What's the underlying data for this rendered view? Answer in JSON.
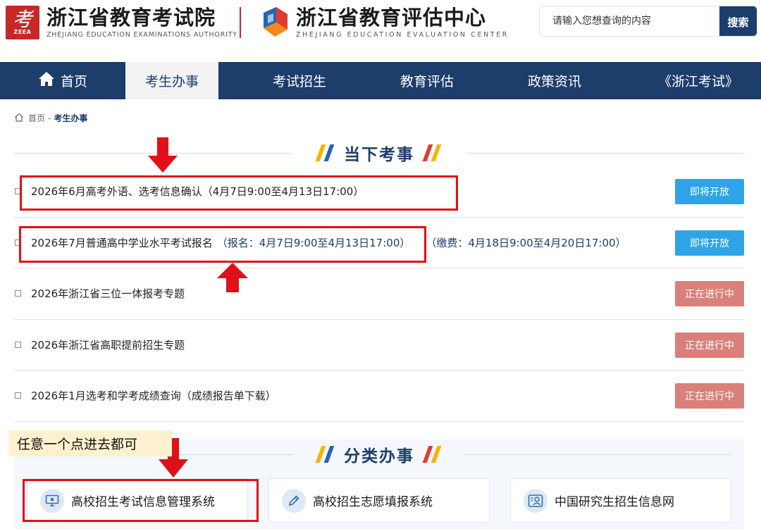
{
  "header": {
    "site1_badge_glyph": "考",
    "site1_badge_abbr": "ZEEA",
    "site1_name": "浙江省教育考试院",
    "site1_name_en": "ZHEJIANG EDUCATION EXAMINATIONS AUTHORITY",
    "site2_name": "浙江省教育评估中心",
    "site2_name_en": "ZHEJIANG EDUCATION EVALUATION CENTER",
    "search_placeholder": "请输入您想查询的内容",
    "search_button": "搜索"
  },
  "nav": {
    "items": [
      {
        "label": "首页",
        "icon": "home-icon"
      },
      {
        "label": "考生办事",
        "active": true
      },
      {
        "label": "考试招生"
      },
      {
        "label": "教育评估"
      },
      {
        "label": "政策资讯"
      },
      {
        "label": "《浙江考试》"
      }
    ]
  },
  "breadcrumb": {
    "home": "首页",
    "sep": "-",
    "current": "考生办事"
  },
  "section_current": {
    "title": "当下考事"
  },
  "events": [
    {
      "text": "2026年6月高考外语、选考信息确认（4月7日9:00至4月13日17:00）",
      "status": "即将开放",
      "status_type": "soon"
    },
    {
      "text": "2026年7月普通高中学业水平考试报名",
      "extra": "（报名：4月7日9:00至4月13日17:00）",
      "extra2": "（缴费：4月18日9:00至4月20日17:00）",
      "status": "即将开放",
      "status_type": "soon"
    },
    {
      "text": "2026年浙江省三位一体报考专题",
      "status": "正在进行中",
      "status_type": "ongoing"
    },
    {
      "text": "2026年浙江省高职提前招生专题",
      "status": "正在进行中",
      "status_type": "ongoing"
    },
    {
      "text": "2026年1月选考和学考成绩查询（成绩报告单下载）",
      "status": "正在进行中",
      "status_type": "ongoing"
    }
  ],
  "section_class": {
    "title": "分类办事"
  },
  "services": [
    {
      "label": "高校招生考试信息管理系统",
      "icon": "monitor-icon"
    },
    {
      "label": "高校招生志愿填报系统",
      "icon": "pencil-icon"
    },
    {
      "label": "中国研究生招生信息网",
      "icon": "user-card-icon"
    }
  ],
  "annotation": {
    "note": "任意一个点进去都可"
  },
  "colors": {
    "brand_navy": "#1d3d6b",
    "soon_blue": "#2ea4e6",
    "ongoing_red": "#d88079",
    "highlight_red": "#e0101a"
  }
}
